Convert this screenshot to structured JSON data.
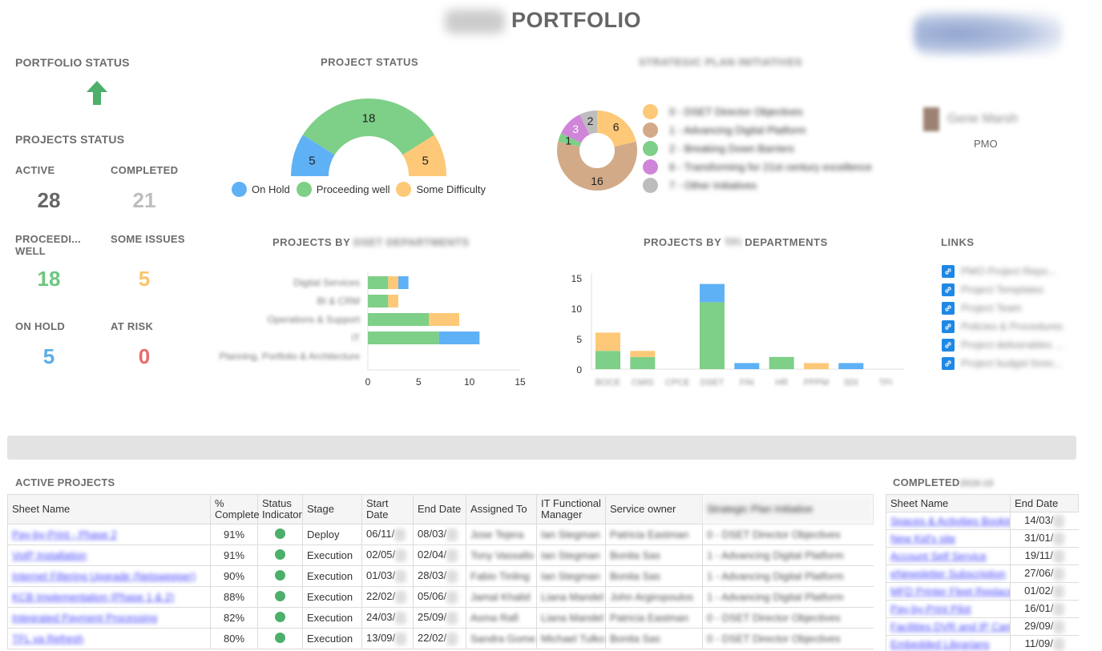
{
  "header": {
    "title": "PORTFOLIO",
    "org_prefix": "DSET"
  },
  "portfolio_status": {
    "title": "PORTFOLIO STATUS",
    "trend_icon": "arrow-up-icon",
    "trend_color": "#4caf6a"
  },
  "projects_status": {
    "title": "PROJECTS STATUS",
    "stats": [
      {
        "label": "ACTIVE",
        "value": "28",
        "color": "#666666"
      },
      {
        "label": "COMPLETED",
        "value": "21",
        "color": "#bdbdbd"
      },
      {
        "label": "PROCEEDI... WELL",
        "value": "18",
        "color": "#6cc77e"
      },
      {
        "label": "SOME ISSUES",
        "value": "5",
        "color": "#f9c56b"
      },
      {
        "label": "ON HOLD",
        "value": "5",
        "color": "#5aade8"
      },
      {
        "label": "AT RISK",
        "value": "0",
        "color": "#e86b6b"
      }
    ]
  },
  "colors": {
    "on_hold": "#5fb1f5",
    "proceeding": "#7ecf87",
    "difficulty": "#fdc978",
    "tan": "#d2aa87",
    "purple": "#cf86d9",
    "gray": "#bdbdbd",
    "link_icon": "#1e88e5"
  },
  "chart_data": [
    {
      "id": "project-status",
      "type": "pie",
      "variant": "half-donut",
      "title": "PROJECT STATUS",
      "labels": [
        "On Hold",
        "Proceeding well",
        "Some Difficulty"
      ],
      "values": [
        5,
        18,
        5
      ],
      "colors": [
        "#5fb1f5",
        "#7ecf87",
        "#fdc978"
      ],
      "legend": "bottom"
    },
    {
      "id": "strategic-plan",
      "type": "pie",
      "variant": "donut",
      "title": "STRATEGIC PLAN INITIATIVES",
      "labels": [
        "0 - DSET Director Objectives",
        "1 - Advancing Digital Platform",
        "2 - Breaking Down Barriers",
        "6 - Transforming for 21st century excellence",
        "7 - Other Initiatives"
      ],
      "values": [
        6,
        16,
        1,
        3,
        2
      ],
      "colors": [
        "#fdc978",
        "#d2aa87",
        "#7ecf87",
        "#cf86d9",
        "#bdbdbd"
      ],
      "legend": "right"
    },
    {
      "id": "by-dset-departments",
      "type": "bar",
      "orientation": "horizontal",
      "stacked": true,
      "title": "PROJECTS BY",
      "title_suffix": "DSET DEPARTMENTS",
      "categories": [
        "Digital Services",
        "BI & CRM",
        "Operations & Support",
        "IT",
        "Planning, Portfolio & Architecture"
      ],
      "series": [
        {
          "name": "Proceeding well",
          "values": [
            2,
            2,
            6,
            7,
            0
          ],
          "color": "#7ecf87"
        },
        {
          "name": "Some Difficulty",
          "values": [
            1,
            1,
            3,
            0,
            0
          ],
          "color": "#fdc978"
        },
        {
          "name": "On Hold",
          "values": [
            1,
            0,
            0,
            4,
            0
          ],
          "color": "#5fb1f5"
        }
      ],
      "xlim": [
        0,
        15
      ],
      "xticks": [
        0,
        5,
        10,
        15
      ]
    },
    {
      "id": "by-departments",
      "type": "bar",
      "orientation": "vertical",
      "stacked": true,
      "title": "PROJECTS BY",
      "title_mid": "TFI",
      "title_suffix": "DEPARTMENTS",
      "categories": [
        "BOCE",
        "CMIS",
        "CPCE",
        "DSET",
        "FIN",
        "HR",
        "PPPM",
        "SDI",
        "TFI"
      ],
      "series": [
        {
          "name": "Proceeding well",
          "values": [
            3,
            2,
            0,
            11,
            0,
            2,
            0,
            0,
            0
          ],
          "color": "#7ecf87"
        },
        {
          "name": "Some Difficulty",
          "values": [
            3,
            1,
            0,
            0,
            0,
            0,
            1,
            0,
            0
          ],
          "color": "#fdc978"
        },
        {
          "name": "On Hold",
          "values": [
            0,
            0,
            0,
            3,
            1,
            0,
            0,
            1,
            0
          ],
          "color": "#5fb1f5"
        }
      ],
      "ylim": [
        0,
        15
      ],
      "yticks": [
        0,
        5,
        10,
        15
      ]
    }
  ],
  "pmo": {
    "name": "Gene Marsh",
    "role": "PMO"
  },
  "links": {
    "title": "LINKS",
    "items": [
      "PMO Project Repo...",
      "Project Templates",
      "Project Team",
      "Policies & Procedures",
      "Project deliverables ...",
      "Project budget forec..."
    ]
  },
  "active_projects": {
    "title": "ACTIVE PROJECTS",
    "columns": [
      "Sheet Name",
      "% Complete",
      "Status Indicator",
      "Stage",
      "Start Date",
      "End Date",
      "Assigned To",
      "IT Functional Manager",
      "Service owner",
      "Strategic Plan Initiative"
    ],
    "rows": [
      {
        "name": "Pay-by-Print - Phase 2",
        "pct": "91%",
        "stage": "Deploy",
        "start": "06/11/",
        "end": "08/03/",
        "assigned": "Jose Tejera",
        "it_mgr": "Ian Stegman",
        "owner": "Patricia Eastman",
        "initiative": "0 - DSET Director Objectives"
      },
      {
        "name": "VoIP Installation",
        "pct": "91%",
        "stage": "Execution",
        "start": "02/05/",
        "end": "02/04/",
        "assigned": "Tony Vassallo",
        "it_mgr": "Ian Stegman",
        "owner": "Bonita Sas",
        "initiative": "1 - Advancing Digital Platform"
      },
      {
        "name": "Internet Filtering Upgrade (Netsweeper)",
        "pct": "90%",
        "stage": "Execution",
        "start": "01/03/",
        "end": "28/03/",
        "assigned": "Fabio Tinling",
        "it_mgr": "Ian Stegman",
        "owner": "Bonita Sas",
        "initiative": "1 - Advancing Digital Platform"
      },
      {
        "name": "KCB Implementation (Phase 1 & 2)",
        "pct": "88%",
        "stage": "Execution",
        "start": "22/02/",
        "end": "05/06/",
        "assigned": "Jamal Khalid",
        "it_mgr": "Liana Mandel",
        "owner": "John Argiropoulos",
        "initiative": "1 - Advancing Digital Platform"
      },
      {
        "name": "Integrated Payment Processing",
        "pct": "82%",
        "stage": "Execution",
        "start": "24/03/",
        "end": "25/09/",
        "assigned": "Asma Rafi",
        "it_mgr": "Liana Mandel",
        "owner": "Patricia Eastman",
        "initiative": "0 - DSET Director Objectives"
      },
      {
        "name": "TFL va Refresh",
        "pct": "80%",
        "stage": "Execution",
        "start": "13/09/",
        "end": "22/02/",
        "assigned": "Sandra Gomez",
        "it_mgr": "Michael Tulko",
        "owner": "Bonita Sas",
        "initiative": "0 - DSET Director Objectives"
      }
    ]
  },
  "completed_projects": {
    "title": "COMPLETED",
    "title_suffix": "2018-19",
    "columns": [
      "Sheet Name",
      "End Date"
    ],
    "rows": [
      {
        "name": "Spaces & Activities Booking",
        "end": "14/03/"
      },
      {
        "name": "New Kid's site",
        "end": "31/01/"
      },
      {
        "name": "Account Self Service",
        "end": "19/11/"
      },
      {
        "name": "eNewsletter Subscription",
        "end": "27/06/"
      },
      {
        "name": "MFD Printer Fleet Replace",
        "end": "01/02/"
      },
      {
        "name": "Pay-by-Print Pilot",
        "end": "16/01/"
      },
      {
        "name": "Facilities DVR and IP Cam",
        "end": "29/09/"
      },
      {
        "name": "Embedded Librarians",
        "end": "11/09/"
      }
    ]
  }
}
